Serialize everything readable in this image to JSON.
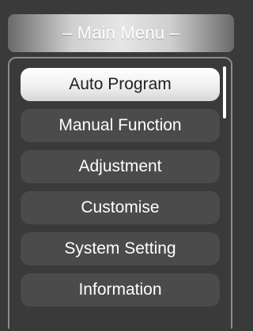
{
  "menu": {
    "title": "– Main Menu –",
    "items": [
      {
        "label": "Auto Program",
        "selected": true
      },
      {
        "label": "Manual Function",
        "selected": false
      },
      {
        "label": "Adjustment",
        "selected": false
      },
      {
        "label": "Customise",
        "selected": false
      },
      {
        "label": "System Setting",
        "selected": false
      },
      {
        "label": "Information",
        "selected": false
      }
    ]
  },
  "colors": {
    "background": "#3a3a3a",
    "item_background": "#4b4b4b",
    "selected_background": "#efefef",
    "text": "#ffffff",
    "selected_text": "#222222"
  }
}
